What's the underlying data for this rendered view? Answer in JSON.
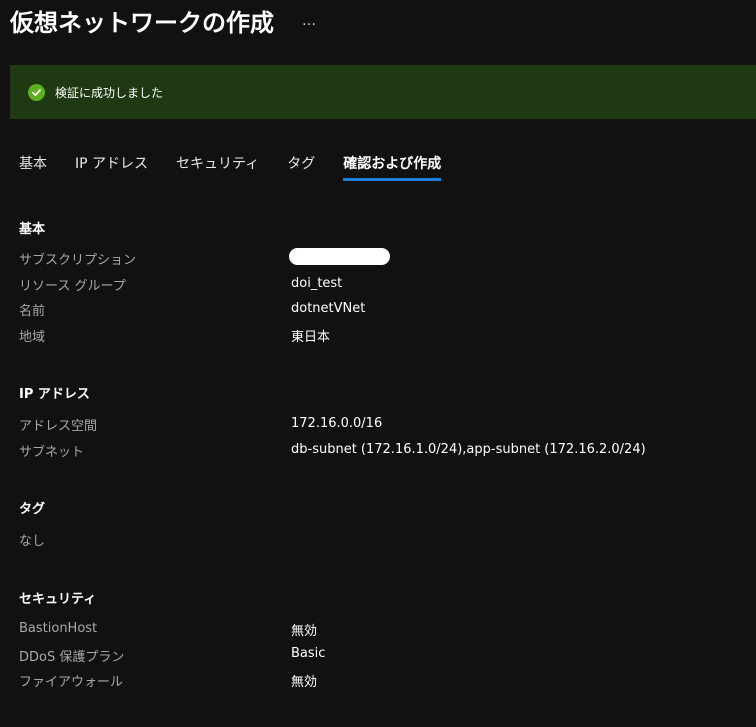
{
  "header": {
    "title": "仮想ネットワークの作成",
    "more_label": "…"
  },
  "banner": {
    "message": "検証に成功しました",
    "status_color": "#5db01f"
  },
  "tabs": [
    {
      "label": "基本"
    },
    {
      "label": "IP アドレス"
    },
    {
      "label": "セキュリティ"
    },
    {
      "label": "タグ"
    },
    {
      "label": "確認および作成",
      "active": true
    }
  ],
  "sections": {
    "basics": {
      "heading": "基本",
      "subscription_label": "サブスクリプション",
      "resource_group_label": "リソース グループ",
      "resource_group_value": "doi_test",
      "name_label": "名前",
      "name_value": "dotnetVNet",
      "region_label": "地域",
      "region_value": "東日本"
    },
    "ip": {
      "heading": "IP アドレス",
      "address_space_label": "アドレス空間",
      "address_space_value": "172.16.0.0/16",
      "subnet_label": "サブネット",
      "subnet_value": "db-subnet (172.16.1.0/24),app-subnet (172.16.2.0/24)"
    },
    "tags": {
      "heading": "タグ",
      "none_text": "なし"
    },
    "security": {
      "heading": "セキュリティ",
      "bastion_label": "BastionHost",
      "bastion_value": "無効",
      "ddos_label": "DDoS 保護プラン",
      "ddos_value": "Basic",
      "firewall_label": "ファイアウォール",
      "firewall_value": "無効"
    }
  },
  "colors": {
    "background": "#111111",
    "banner_bg": "#1f3a12",
    "tab_underline": "#1b7fd6"
  }
}
